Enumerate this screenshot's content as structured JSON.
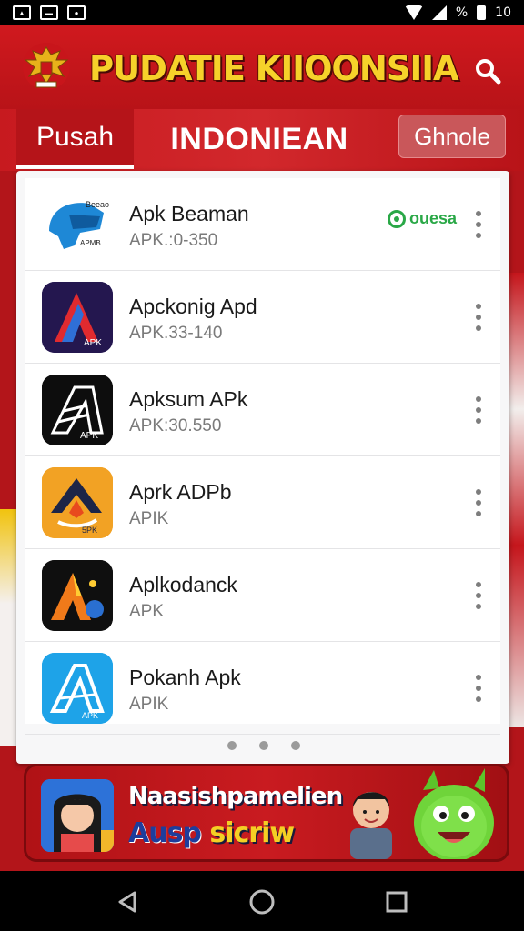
{
  "status_bar": {
    "left_icons": [
      "photo-icon",
      "news-icon",
      "game-icon"
    ],
    "right_text": "%",
    "right_time": "10"
  },
  "header": {
    "title": "PUDATIE KIIOONSIIA",
    "search_icon": "search-icon"
  },
  "tabs": [
    {
      "label": "Pusah"
    },
    {
      "label": "INDONIEAN"
    },
    {
      "label": "Ghnole"
    }
  ],
  "apps": [
    {
      "name": "Apk Beaman",
      "sub": "APK.:0-350",
      "badge": "ouesa"
    },
    {
      "name": "Apckonig Apd",
      "sub": "APK.33-140"
    },
    {
      "name": "Apksum APk",
      "sub": "APK:30.550"
    },
    {
      "name": "Aprk ADPb",
      "sub": "APIK"
    },
    {
      "name": "Aplkodanck",
      "sub": "APK"
    },
    {
      "name": "Pokanh Apk",
      "sub": "APIK"
    }
  ],
  "app_icon_labels": {
    "icon1_top": "Beeao",
    "icon1_bottom": "APMB",
    "icon2": "APK",
    "icon3": "APK",
    "icon4": "5PK",
    "icon6": "APK"
  },
  "pager": {
    "pages": 3
  },
  "banner": {
    "line1": "Naasishpamelien",
    "line2_a": "Ausp",
    "line2_b": "sicriw"
  },
  "colors": {
    "brand_red": "#c71a1f",
    "title_yellow": "#f6d12a",
    "open_green": "#2aa847"
  }
}
